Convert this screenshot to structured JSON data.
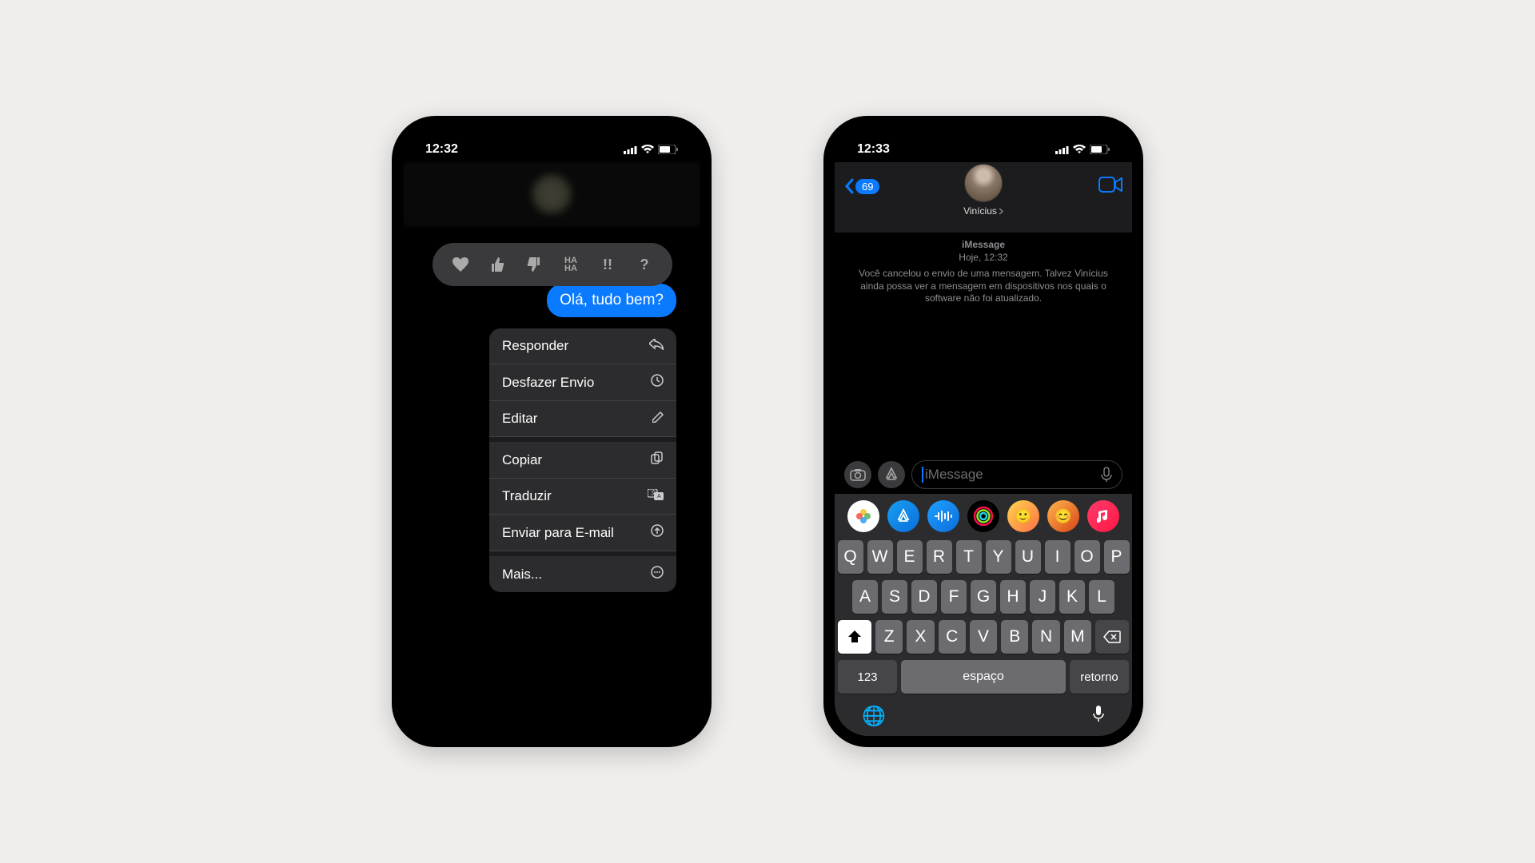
{
  "phone1": {
    "time": "12:32",
    "message": "Olá, tudo bem?",
    "tapbacks": [
      "heart",
      "thumbs-up",
      "thumbs-down",
      "haha",
      "exclaim",
      "question"
    ],
    "menu": {
      "reply": "Responder",
      "undo": "Desfazer Envio",
      "edit": "Editar",
      "copy": "Copiar",
      "translate": "Traduzir",
      "send_email": "Enviar para E-mail",
      "more": "Mais..."
    }
  },
  "phone2": {
    "time": "12:33",
    "back_badge": "69",
    "contact_name": "Vinícius",
    "service": "iMessage",
    "timestamp": "Hoje, 12:32",
    "undo_note": "Você cancelou o envio de uma mensagem. Talvez Vinícius ainda possa ver a mensagem em dispositivos nos quais o software não foi atualizado.",
    "input_placeholder": "iMessage",
    "keyboard": {
      "row1": [
        "Q",
        "W",
        "E",
        "R",
        "T",
        "Y",
        "U",
        "I",
        "O",
        "P"
      ],
      "row2": [
        "A",
        "S",
        "D",
        "F",
        "G",
        "H",
        "J",
        "K",
        "L"
      ],
      "row3": [
        "Z",
        "X",
        "C",
        "V",
        "B",
        "N",
        "M"
      ],
      "numbers": "123",
      "space": "espaço",
      "return": "retorno"
    }
  }
}
